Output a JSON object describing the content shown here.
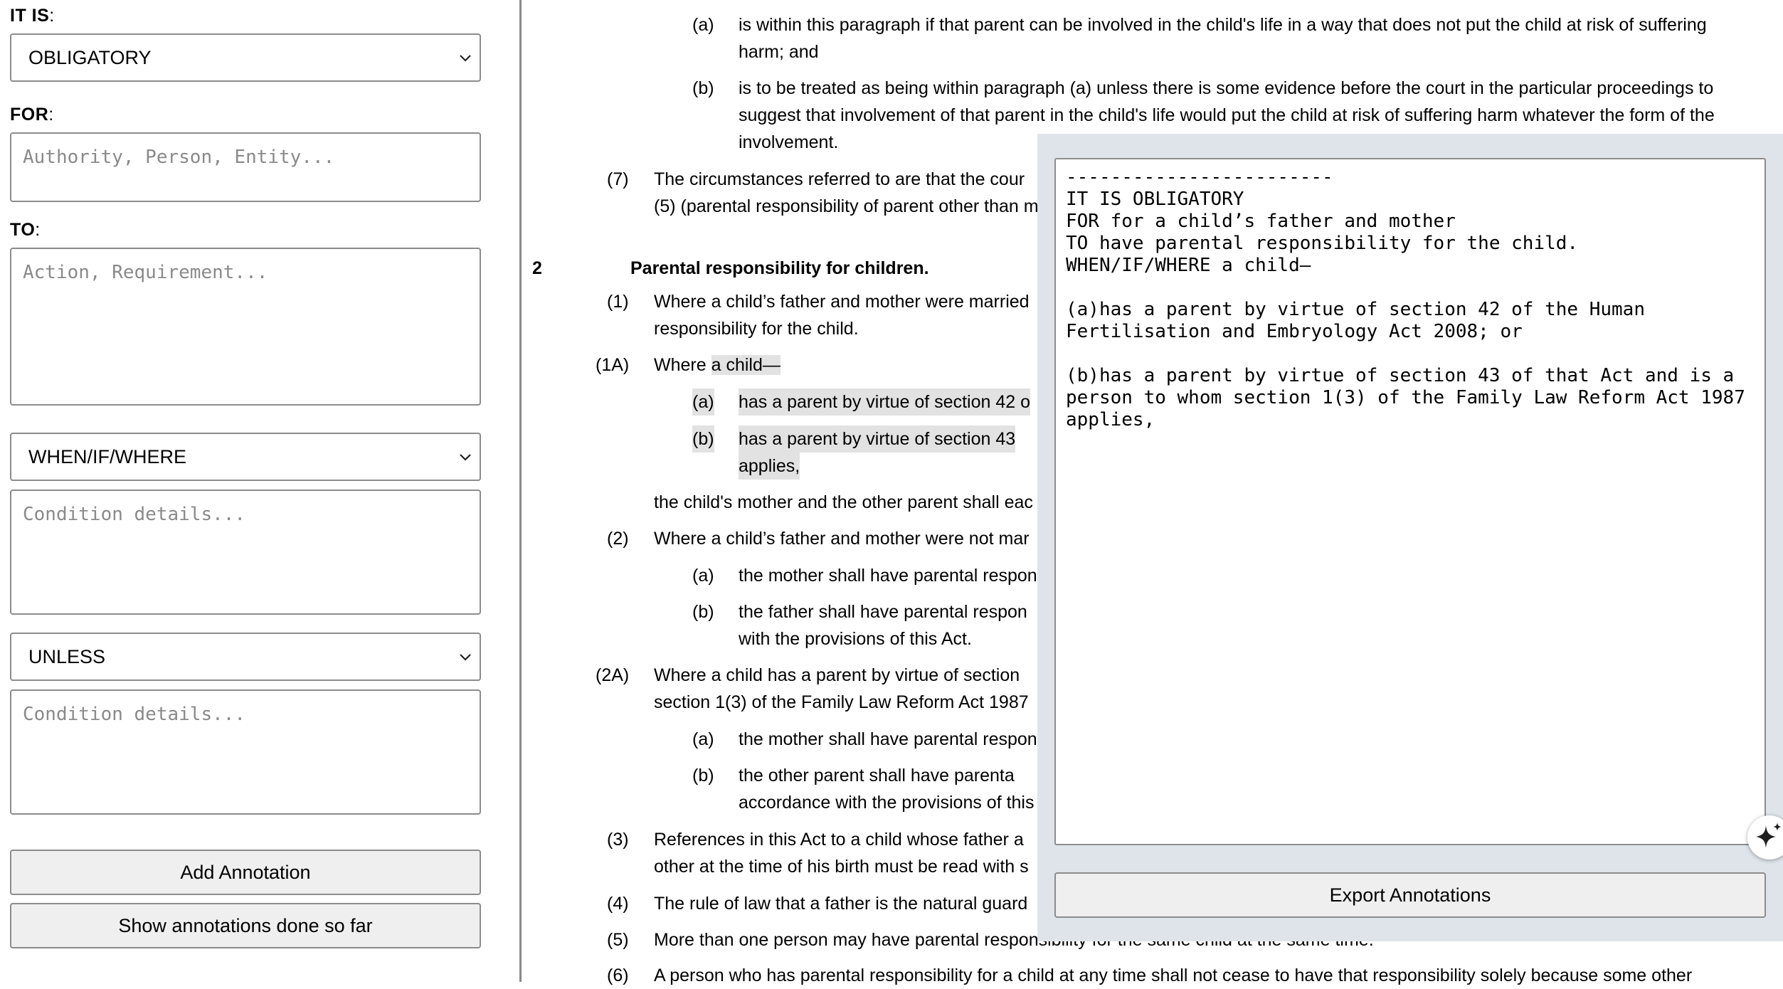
{
  "left_panel": {
    "it_is_label": "IT IS",
    "it_is_value": "OBLIGATORY",
    "for_label": "FOR",
    "for_placeholder": "Authority, Person, Entity...",
    "to_label": "TO",
    "to_placeholder": "Action, Requirement...",
    "when_value": "WHEN/IF/WHERE",
    "when_placeholder": "Condition details...",
    "unless_value": "UNLESS",
    "unless_placeholder": "Condition details...",
    "add_button": "Add Annotation",
    "show_button": "Show annotations done so far"
  },
  "document": {
    "p6a_num": "(a)",
    "p6a_line1": "is within this paragraph if that parent can be involved in the child's life in a way that does not put the child at risk of suffering",
    "p6a_line2": "harm; and",
    "p6b_num": "(b)",
    "p6b_line1": "is to be treated as being within paragraph (a) unless there is some evidence before the court in the particular proceedings to",
    "p6b_line2": "suggest that involvement of that parent in the child's life would put the child at risk of suffering harm whatever the form of the",
    "p6b_line3": "involvement.",
    "p7_num": "(7)",
    "p7_line1": "The circumstances referred to are that the cour",
    "p7_line2": "(5) (parental responsibility of parent other than m",
    "s2_num": "2",
    "s2_title": "Parental responsibility for children.",
    "s1_num": "(1)",
    "s1_line1": "Where a child’s father and mother were married",
    "s1_line2": "responsibility for the child.",
    "s1a_num": "(1A)",
    "s1a_text_a": "Where ",
    "s1a_text_b": "a child—",
    "s1a_a_num": "(a)",
    "s1a_a_text": "has a parent by virtue of section 42 o",
    "s1a_b_num": "(b)",
    "s1a_b_line1": "has a parent by virtue of section 43",
    "s1a_b_line2": "applies,",
    "s1a_tail": "the child's mother and the other parent shall eac",
    "s2_2_num": "(2)",
    "s2_2_text": "Where a child’s father and mother were not mar",
    "s2_2a_num": "(a)",
    "s2_2a_text": "the mother shall have parental respon",
    "s2_2b_num": "(b)",
    "s2_2b_line1": "the father shall have parental respon",
    "s2_2b_line2": "with the provisions of this Act.",
    "s2a_num": "(2A)",
    "s2a_line1": "Where a child has a parent by virtue of section",
    "s2a_line2": "section 1(3) of the Family Law Reform Act 1987",
    "s2a_a_num": "(a)",
    "s2a_a_text": "the mother shall have parental respon",
    "s2a_b_num": "(b)",
    "s2a_b_line1": "the other parent shall have parenta",
    "s2a_b_line2": "accordance with the provisions of this",
    "s3_num": "(3)",
    "s3_line1": "References in this Act to a child whose father a",
    "s3_line2": "other at the time of his birth must be read with s",
    "s4_num": "(4)",
    "s4_text": "The rule of law that a father is the natural guard",
    "s5_num": "(5)",
    "s5_text": "More than one person may have parental responsibility for the same child at the same time.",
    "s6_num": "(6)",
    "s6_text": "A person who has parental responsibility for a child at any time shall not cease to have that responsibility solely because some other"
  },
  "overlay": {
    "preview_text": "------------------------\nIT IS OBLIGATORY\nFOR for a child’s father and mother\nTO have parental responsibility for the child.\nWHEN/IF/WHERE a child—\n\n(a)has a parent by virtue of section 42 of the Human Fertilisation and Embryology Act 2008; or\n\n(b)has a parent by virtue of section 43 of that Act and is a person to whom section 1(3) of the Family Law Reform Act 1987 applies,",
    "export_button": "Export Annotations"
  },
  "icons": {
    "dropdown": "chevron-down-icon",
    "assistant": "sparkle-icon"
  }
}
